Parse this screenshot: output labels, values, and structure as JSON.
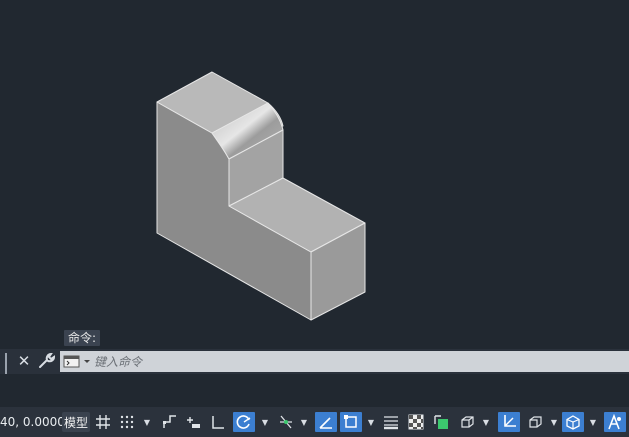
{
  "history": {
    "text": "命令:"
  },
  "command": {
    "placeholder": "键入命令"
  },
  "status": {
    "coordinates": "40, 0.0000",
    "model_tab": "模型"
  },
  "colors": {
    "canvas": "#212830",
    "accent": "#3c7fd1",
    "statusbar": "#2b323c"
  }
}
